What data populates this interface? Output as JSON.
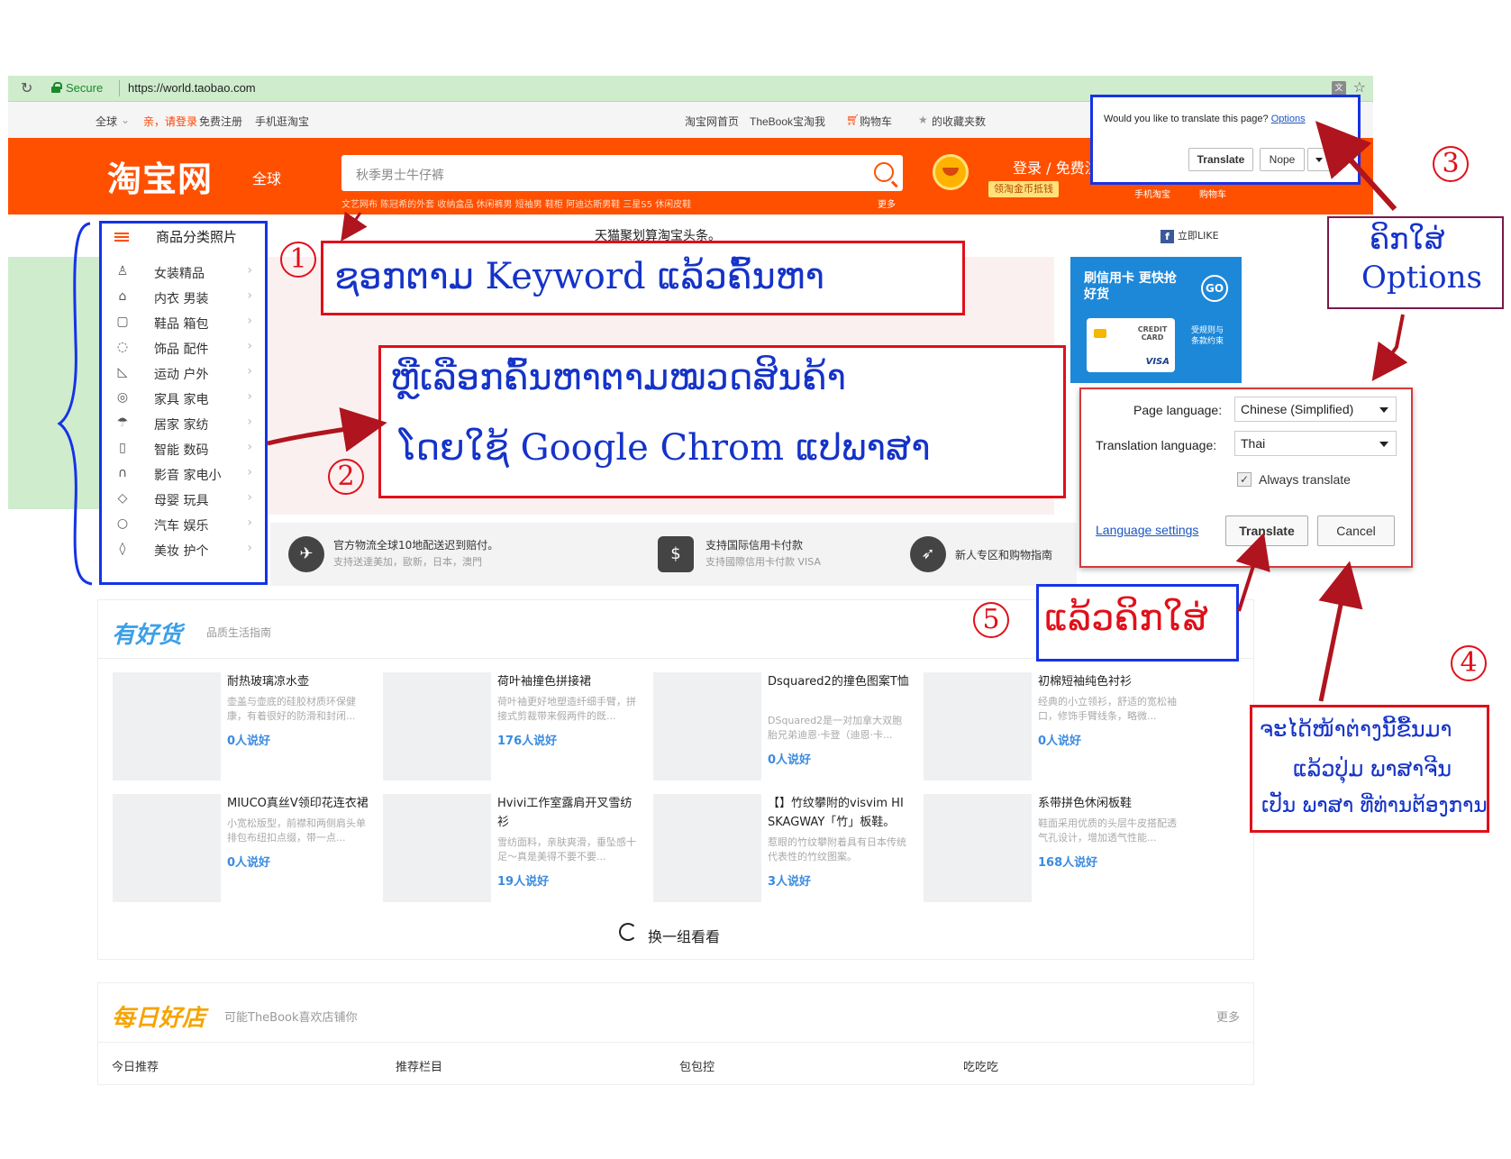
{
  "browser": {
    "secure_label": "Secure",
    "url": "https://world.taobao.com"
  },
  "topnav": {
    "region": "全球",
    "greeting": "亲，请登录",
    "register": "免费注册",
    "mobile": "手机逛淘宝",
    "home": "淘宝网首页",
    "my_taobao": "TheBook宝淘我",
    "cart": "购物车",
    "favorites": "的收藏夹数"
  },
  "header": {
    "logo": "淘宝网",
    "logo_global": "全球",
    "search_placeholder": "秋季男士牛仔裤",
    "hot_words": "文艺网布   陈冠希的外套   收纳盒品   休闲裤男   短袖男   鞋柜   阿迪达斯男鞋   三星S5   休闲皮鞋",
    "hot_more": "更多",
    "login_links": "登录 / 免费注册",
    "coin_badge": "领淘金币抵钱",
    "mobile_taobao": "手机淘宝",
    "cart": "购物车"
  },
  "translate_popup": {
    "question": "Would you like to translate this page?",
    "options_link": "Options",
    "translate_button": "Translate",
    "nope_button": "Nope"
  },
  "headline": "天猫聚划算淘宝头条。",
  "fb_like": "立即LIKE",
  "ad": {
    "title": "刷信用卡 更快抢好货",
    "go": "GO",
    "card_text": "CREDIT CARD",
    "visa": "VISA",
    "small_text": "受规则与条款约束"
  },
  "categories": {
    "title": "商品分类照片",
    "items": [
      {
        "icon": "♙",
        "label": "女装精品"
      },
      {
        "icon": "⌂",
        "label": "内衣 男装"
      },
      {
        "icon": "▢",
        "label": "鞋品 箱包"
      },
      {
        "icon": "◌",
        "label": "饰品 配件"
      },
      {
        "icon": "◺",
        "label": "运动 户外"
      },
      {
        "icon": "◎",
        "label": "家具 家电"
      },
      {
        "icon": "☂",
        "label": "居家 家纺"
      },
      {
        "icon": "▯",
        "label": "智能 数码"
      },
      {
        "icon": "∩",
        "label": "影音 家电小"
      },
      {
        "icon": "◇",
        "label": "母婴 玩具"
      },
      {
        "icon": "○",
        "label": "汽车 娱乐"
      },
      {
        "icon": "◊",
        "label": "美妆 护个"
      }
    ]
  },
  "services": [
    {
      "title": "官方物流全球10地配送迟到赔付。",
      "sub": "支持送達美加，歐新，日本，澳門"
    },
    {
      "title": "支持国际信用卡付款",
      "sub": "支持國際信用卡付款   VISA"
    },
    {
      "title": "新人专区和购物指南",
      "sub": ""
    }
  ],
  "translate_options": {
    "page_language_label": "Page language:",
    "page_language_value": "Chinese (Simplified)",
    "translation_language_label": "Translation language:",
    "translation_language_value": "Thai",
    "always_translate": "Always translate",
    "language_settings": "Language settings",
    "translate_button": "Translate",
    "cancel_button": "Cancel"
  },
  "goods": {
    "title": "有好货",
    "subtitle": "品质生活指南",
    "refresh": "换一组看看",
    "items": [
      {
        "name": "耐热玻璃凉水壶",
        "desc": "壶盖与壶底的硅胶材质环保健康，有着很好的防滑和封闭...",
        "count": "0人说好"
      },
      {
        "name": "荷叶袖撞色拼接裙",
        "desc": "荷叶袖更好地塑造纤细手臂，拼接式剪裁带来假两件的既...",
        "count": "176人说好"
      },
      {
        "name": "Dsquared2的撞色图案T恤",
        "desc": "DSquared2是一对加拿大双胞胎兄弟迪恩·卡登（迪恩·卡...",
        "count": "0人说好"
      },
      {
        "name": "初棉短袖纯色衬衫",
        "desc": "经典的小立领衫，舒适的宽松袖口，修饰手臂线条，略微...",
        "count": "0人说好"
      },
      {
        "name": "MIUCO真丝V领印花连衣裙",
        "desc": "小宽松版型，前襟和两侧肩头单排包布纽扣点缀，带一点...",
        "count": "0人说好"
      },
      {
        "name": "Hvivi工作室露肩开叉雪纺衫",
        "desc": "雪纺面料，亲肤爽滑，垂坠感十足～真是美得不要不要...",
        "count": "19人说好"
      },
      {
        "name": "【】竹纹攀附的visvim HI SKAGWAY「竹」板鞋。",
        "desc": "惹眼的竹纹攀附着具有日本传统代表性的竹纹图案。",
        "count": "3人说好"
      },
      {
        "name": "系带拼色休闲板鞋",
        "desc": "鞋面采用优质的头层牛皮搭配透气孔设计，增加透气性能...",
        "count": "168人说好"
      }
    ]
  },
  "daily": {
    "title": "每日好店",
    "subtitle": "可能TheBook喜欢店铺你",
    "more": "更多",
    "tabs": [
      "今日推荐",
      "推荐栏目",
      "包包控",
      "吃吃吃"
    ]
  },
  "annotations": {
    "n1": "1",
    "n2": "2",
    "n3": "3",
    "n4": "4",
    "n5": "5",
    "note1": "ຊອກຕາມ  Keyword ແລ້ວຄົ້ນຫາ",
    "note2_line1": "ຫຼືເລືອກຄົ້ນຫາຕາມໝວດສິນຄ້າ",
    "note2_line2": "ໂດຍໃຊ້ Google Chrom ແປພາສາ",
    "note3_line1": "ຄິກໃສ່",
    "note3_line2": "Options",
    "note4_line1": "ຈະໄດ້ໜ້າຕ່າງນີ້ຂື້ນມາ",
    "note4_line2": "ແລ້ວປຸ່ມ ພາສາຈີນ",
    "note4_line3": "ເປັນ ພາສາ ທີ່ທ່ານຕ້ອງການ",
    "note5": "ແລ້ວຄິກໃສ່"
  },
  "colors": {
    "taobao_orange": "#ff5000",
    "annotation_blue": "#1533e8",
    "annotation_red": "#e0101a",
    "arrow_red": "#b0141e"
  }
}
